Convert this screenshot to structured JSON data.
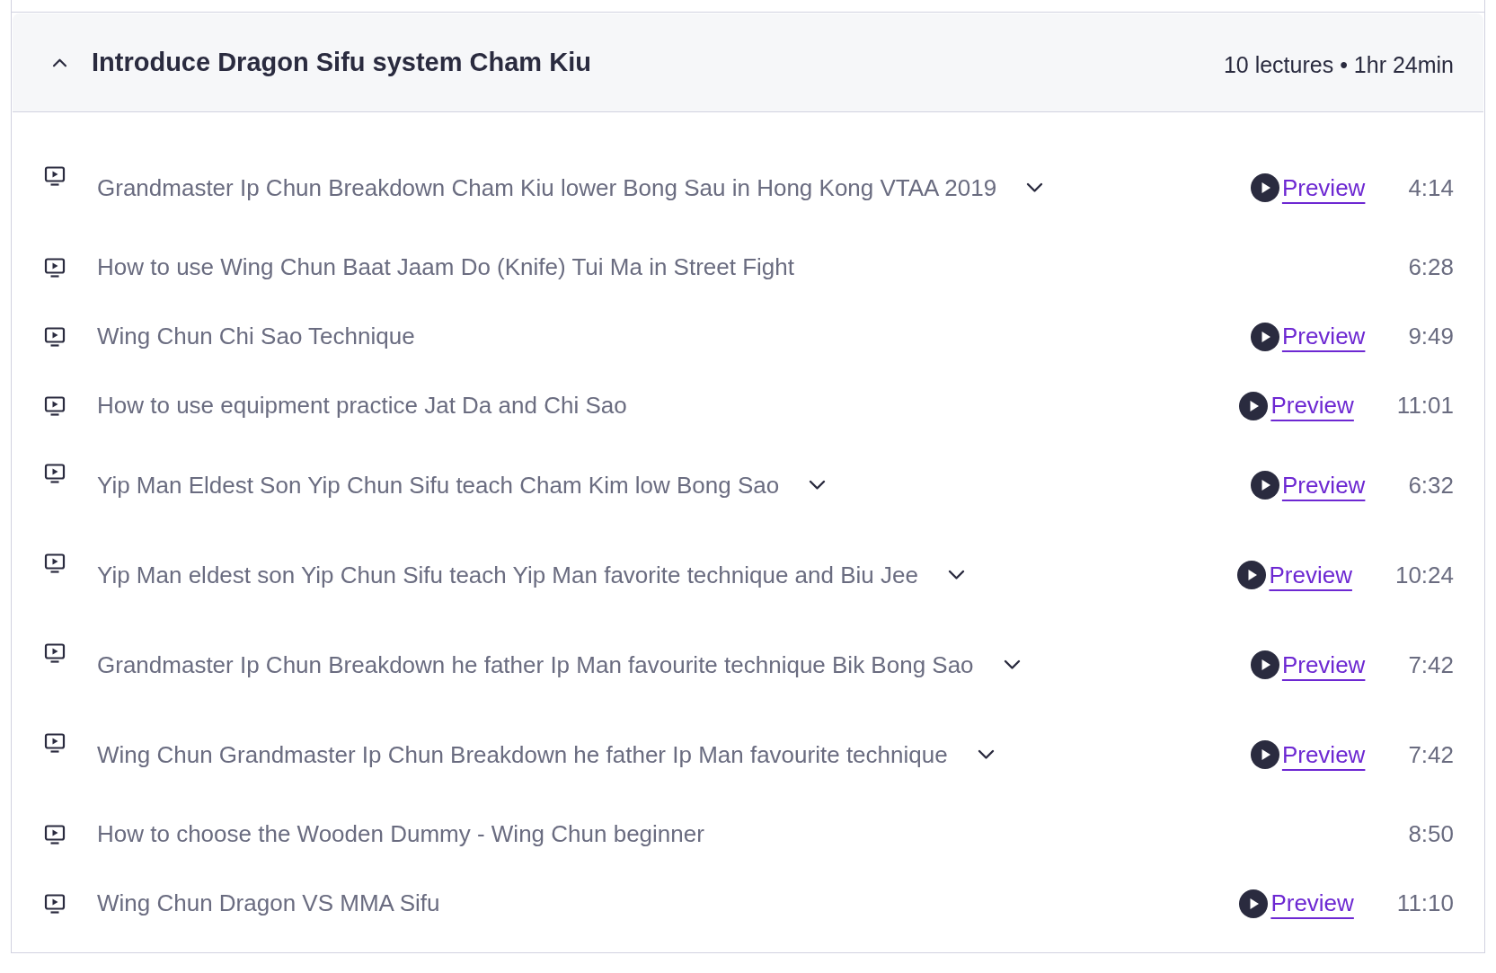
{
  "section": {
    "title": "Introduce Dragon Sifu system Cham Kiu",
    "expanded": true,
    "summary": "10 lectures • 1hr 24min",
    "lectures": [
      {
        "title": "Grandmaster Ip Chun Breakdown Cham Kiu lower Bong Sau in Hong Kong VTAA 2019",
        "has_description": true,
        "preview": "Preview",
        "duration": "4:14"
      },
      {
        "title": "How to use Wing Chun Baat Jaam Do (Knife) Tui Ma in Street Fight",
        "has_description": false,
        "duration": "6:28"
      },
      {
        "title": "Wing Chun Chi Sao Technique",
        "has_description": false,
        "preview": "Preview",
        "duration": "9:49"
      },
      {
        "title": "How to use equipment practice Jat Da and Chi Sao",
        "has_description": false,
        "preview": "Preview",
        "duration": "11:01"
      },
      {
        "title": "Yip Man Eldest Son Yip Chun Sifu teach Cham Kim low Bong Sao",
        "has_description": true,
        "preview": "Preview",
        "duration": "6:32"
      },
      {
        "title": "Yip Man eldest son Yip Chun Sifu teach Yip Man favorite technique and Biu Jee",
        "has_description": true,
        "preview": "Preview",
        "duration": "10:24"
      },
      {
        "title": "Grandmaster Ip Chun Breakdown he father Ip Man favourite technique Bik Bong Sao",
        "has_description": true,
        "preview": "Preview",
        "duration": "7:42"
      },
      {
        "title": "Wing Chun Grandmaster Ip Chun Breakdown he father Ip Man favourite technique",
        "has_description": true,
        "preview": "Preview",
        "duration": "7:42"
      },
      {
        "title": "How to choose the Wooden Dummy - Wing Chun beginner",
        "has_description": false,
        "duration": "8:50"
      },
      {
        "title": "Wing Chun Dragon VS MMA Sifu",
        "has_description": false,
        "preview": "Preview",
        "duration": "11:10"
      }
    ]
  }
}
